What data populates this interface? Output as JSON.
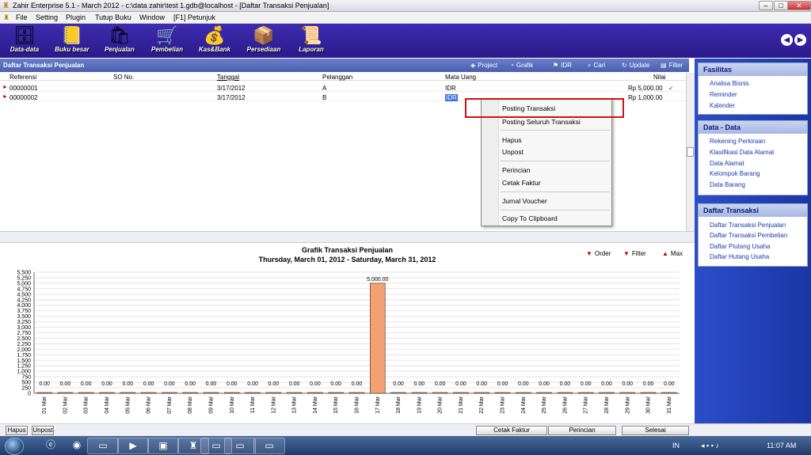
{
  "window": {
    "title": "Zahir Enterprise 5.1 - March 2012 - c:\\data zahir\\test 1.gdb@localhost - [Daftar Transaksi Penjualan]"
  },
  "menu": [
    "File",
    "Setting",
    "Plugin",
    "Tutup Buku",
    "Window",
    "[F1] Petunjuk"
  ],
  "toolbar": [
    {
      "label": "Data-data",
      "icon": "data-icon"
    },
    {
      "label": "Buku besar",
      "icon": "ledger-icon"
    },
    {
      "label": "Penjualan",
      "icon": "sales-icon"
    },
    {
      "label": "Pembelian",
      "icon": "purchase-icon"
    },
    {
      "label": "Kas&Bank",
      "icon": "cash-bank-icon"
    },
    {
      "label": "Persediaan",
      "icon": "inventory-icon"
    },
    {
      "label": "Laporan",
      "icon": "report-icon"
    }
  ],
  "panel": {
    "title": "Daftar Transaksi Penjualan",
    "buttons": [
      "Project",
      "Grafik",
      "IDR",
      "Cari",
      "Update",
      "Filter"
    ]
  },
  "table": {
    "headers": [
      "Referensi",
      "SO No.",
      "Tanggal",
      "Pelanggan",
      "Mata Uang",
      "Nilai"
    ],
    "rows": [
      {
        "ref": "00000001",
        "so": "",
        "date": "3/17/2012",
        "customer": "A",
        "currency": "IDR",
        "value": "Rp 5,000.00",
        "check": "✓"
      },
      {
        "ref": "00000002",
        "so": "",
        "date": "3/17/2012",
        "customer": "B",
        "currency": "IDR",
        "value": "Rp 1,000.00",
        "check": ""
      }
    ]
  },
  "context_menu": [
    "Posting Transaksi",
    "Posting Seluruh Transaksi",
    "Hapus",
    "Unpost",
    "Perincian",
    "Cetak Faktur",
    "Jurnal Voucher",
    "Copy To Clipboard"
  ],
  "chart_controls": [
    "Order",
    "Filter",
    "Max"
  ],
  "chart_data": {
    "type": "bar",
    "title": "Grafik Transaksi Penjualan",
    "subtitle": "Thursday, March 01, 2012 - Saturday, March 31, 2012",
    "categories": [
      "01 Mar",
      "02 Mar",
      "03 Mar",
      "04 Mar",
      "05 Mar",
      "06 Mar",
      "07 Mar",
      "08 Mar",
      "09 Mar",
      "10 Mar",
      "11 Mar",
      "12 Mar",
      "13 Mar",
      "14 Mar",
      "15 Mar",
      "16 Mar",
      "17 Mar",
      "18 Mar",
      "19 Mar",
      "20 Mar",
      "21 Mar",
      "22 Mar",
      "23 Mar",
      "24 Mar",
      "25 Mar",
      "26 Mar",
      "27 Mar",
      "28 Mar",
      "29 Mar",
      "30 Mar",
      "31 Mar"
    ],
    "values": [
      0,
      0,
      0,
      0,
      0,
      0,
      0,
      0,
      0,
      0,
      0,
      0,
      0,
      0,
      0,
      0,
      5000,
      0,
      0,
      0,
      0,
      0,
      0,
      0,
      0,
      0,
      0,
      0,
      0,
      0,
      0
    ],
    "value_labels": [
      "0.00",
      "0.00",
      "0.00",
      "0.00",
      "0.00",
      "0.00",
      "0.00",
      "0.00",
      "0.00",
      "0.00",
      "0.00",
      "0.00",
      "0.00",
      "0.00",
      "0.00",
      "0.00",
      "5,000.00",
      "0.00",
      "0.00",
      "0.00",
      "0.00",
      "0.00",
      "0.00",
      "0.00",
      "0.00",
      "0.00",
      "0.00",
      "0.00",
      "0.00",
      "0.00",
      "0.00"
    ],
    "yticks": [
      "0",
      "250",
      "500",
      "750",
      "1,000",
      "1,250",
      "1,500",
      "1,750",
      "2,000",
      "2,250",
      "2,500",
      "2,750",
      "3,000",
      "3,250",
      "3,500",
      "3,750",
      "4,000",
      "4,250",
      "4,500",
      "4,750",
      "5,000",
      "5,250",
      "5,500"
    ],
    "ylim": [
      0,
      5500
    ],
    "xlabel": "",
    "ylabel": "",
    "grid": true,
    "bar_color": "#f4a070"
  },
  "sidebar": [
    {
      "title": "Fasilitas",
      "links": [
        "Analisa Bisnis",
        "Reminder",
        "Kalender"
      ]
    },
    {
      "title": "Data - Data",
      "links": [
        "Rekening Perkiraan",
        "Klasifikasi Data Alamat",
        "Data Alamat",
        "Kelompok Barang",
        "Data Barang"
      ]
    },
    {
      "title": "Daftar Transaksi",
      "links": [
        "Daftar Transaksi Penjualan",
        "Daftar Transaksi Pembelian",
        "Daftar Piutang Usaha",
        "Daftar Hutang Usaha"
      ]
    }
  ],
  "bottom": {
    "left": [
      "Hapus",
      "Unpost"
    ],
    "right": [
      "Cetak Faktur",
      "Perincian",
      "Selesai"
    ]
  },
  "taskbar": {
    "lang": "IN",
    "time": "11:07 AM"
  }
}
